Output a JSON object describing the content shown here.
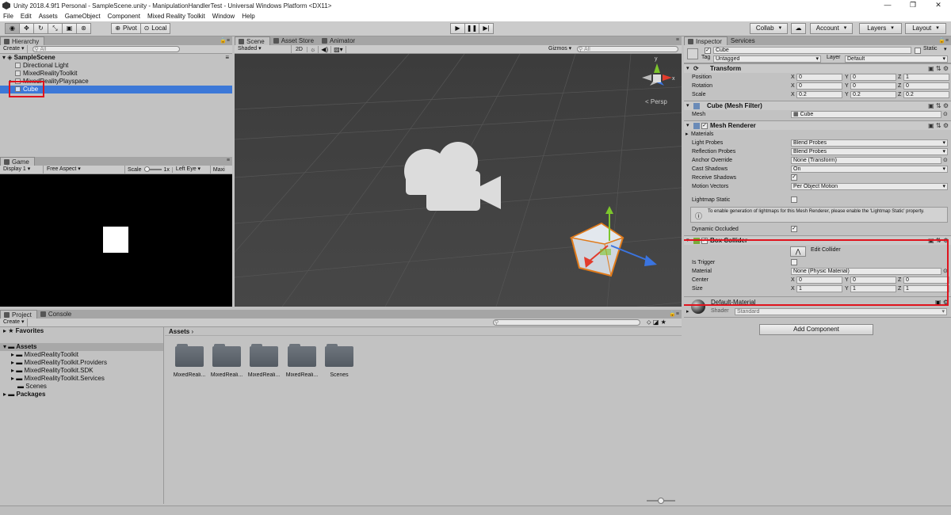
{
  "window": {
    "title": "Unity 2018.4.9f1 Personal - SampleScene.unity - ManipulationHandlerTest - Universal Windows Platform <DX11>",
    "minimize": "—",
    "maximize": "❐",
    "close": "✕"
  },
  "menu": [
    "File",
    "Edit",
    "Assets",
    "GameObject",
    "Component",
    "Mixed Reality Toolkit",
    "Window",
    "Help"
  ],
  "toolbar": {
    "pivot": "Pivot",
    "local": "Local",
    "collab": "Collab",
    "account": "Account",
    "layers": "Layers",
    "layout": "Layout"
  },
  "hierarchy": {
    "tab": "Hierarchy",
    "create": "Create",
    "search_placeholder": "All",
    "scene": "SampleScene",
    "items": [
      "Directional Light",
      "MixedRealityToolkit",
      "MixedRealityPlayspace",
      "Cube"
    ]
  },
  "scene_panel": {
    "tabs": [
      "Scene",
      "Asset Store",
      "Animator"
    ],
    "shading": "Shaded",
    "mode_2d": "2D",
    "gizmos": "Gizmos",
    "search_placeholder": "All",
    "persp": "< Persp",
    "axis_y": "y",
    "axis_x": "x"
  },
  "game_panel": {
    "tab": "Game",
    "display": "Display 1",
    "aspect": "Free Aspect",
    "scale_label": "Scale",
    "scale_value": "1x",
    "eye": "Left Eye",
    "maxi": "Maxi"
  },
  "inspector": {
    "tabs": [
      "Inspector",
      "Services"
    ],
    "object_name": "Cube",
    "static_label": "Static",
    "tag_label": "Tag",
    "tag_value": "Untagged",
    "layer_label": "Layer",
    "layer_value": "Default",
    "transform": {
      "title": "Transform",
      "position": {
        "label": "Position",
        "x": "0",
        "y": "0",
        "z": "1"
      },
      "rotation": {
        "label": "Rotation",
        "x": "0",
        "y": "0",
        "z": "0"
      },
      "scale": {
        "label": "Scale",
        "x": "0.2",
        "y": "0.2",
        "z": "0.2"
      }
    },
    "mesh_filter": {
      "title": "Cube (Mesh Filter)",
      "mesh_label": "Mesh",
      "mesh_value": "Cube"
    },
    "mesh_renderer": {
      "title": "Mesh Renderer",
      "materials": "Materials",
      "rows": [
        {
          "label": "Light Probes",
          "value": "Blend Probes"
        },
        {
          "label": "Reflection Probes",
          "value": "Blend Probes"
        },
        {
          "label": "Anchor Override",
          "value": "None (Transform)"
        },
        {
          "label": "Cast Shadows",
          "value": "On"
        },
        {
          "label": "Receive Shadows",
          "value": ""
        },
        {
          "label": "Motion Vectors",
          "value": "Per Object Motion"
        }
      ],
      "lightmap_static": "Lightmap Static",
      "info": "To enable generation of lightmaps for this Mesh Renderer, please enable the 'Lightmap Static' property.",
      "dynamic_occluded": "Dynamic Occluded"
    },
    "box_collider": {
      "title": "Box Collider",
      "edit_collider": "Edit Collider",
      "is_trigger": "Is Trigger",
      "material_label": "Material",
      "material_value": "None (Physic Material)",
      "center": {
        "label": "Center",
        "x": "0",
        "y": "0",
        "z": "0"
      },
      "size": {
        "label": "Size",
        "x": "1",
        "y": "1",
        "z": "1"
      }
    },
    "material": {
      "name": "Default-Material",
      "shader_label": "Shader",
      "shader_value": "Standard"
    },
    "add_component": "Add Component"
  },
  "project": {
    "tabs": [
      "Project",
      "Console"
    ],
    "create": "Create",
    "favorites": "Favorites",
    "assets": "Assets",
    "tree": [
      "MixedRealityToolkit",
      "MixedRealityToolkit.Providers",
      "MixedRealityToolkit.SDK",
      "MixedRealityToolkit.Services",
      "Scenes"
    ],
    "packages": "Packages",
    "breadcrumb": "Assets",
    "folders": [
      "MixedReali...",
      "MixedReali...",
      "MixedReali...",
      "MixedReali...",
      "Scenes"
    ]
  },
  "colors": {
    "selection": "#3c78d8",
    "highlight_box": "#e0131d"
  }
}
